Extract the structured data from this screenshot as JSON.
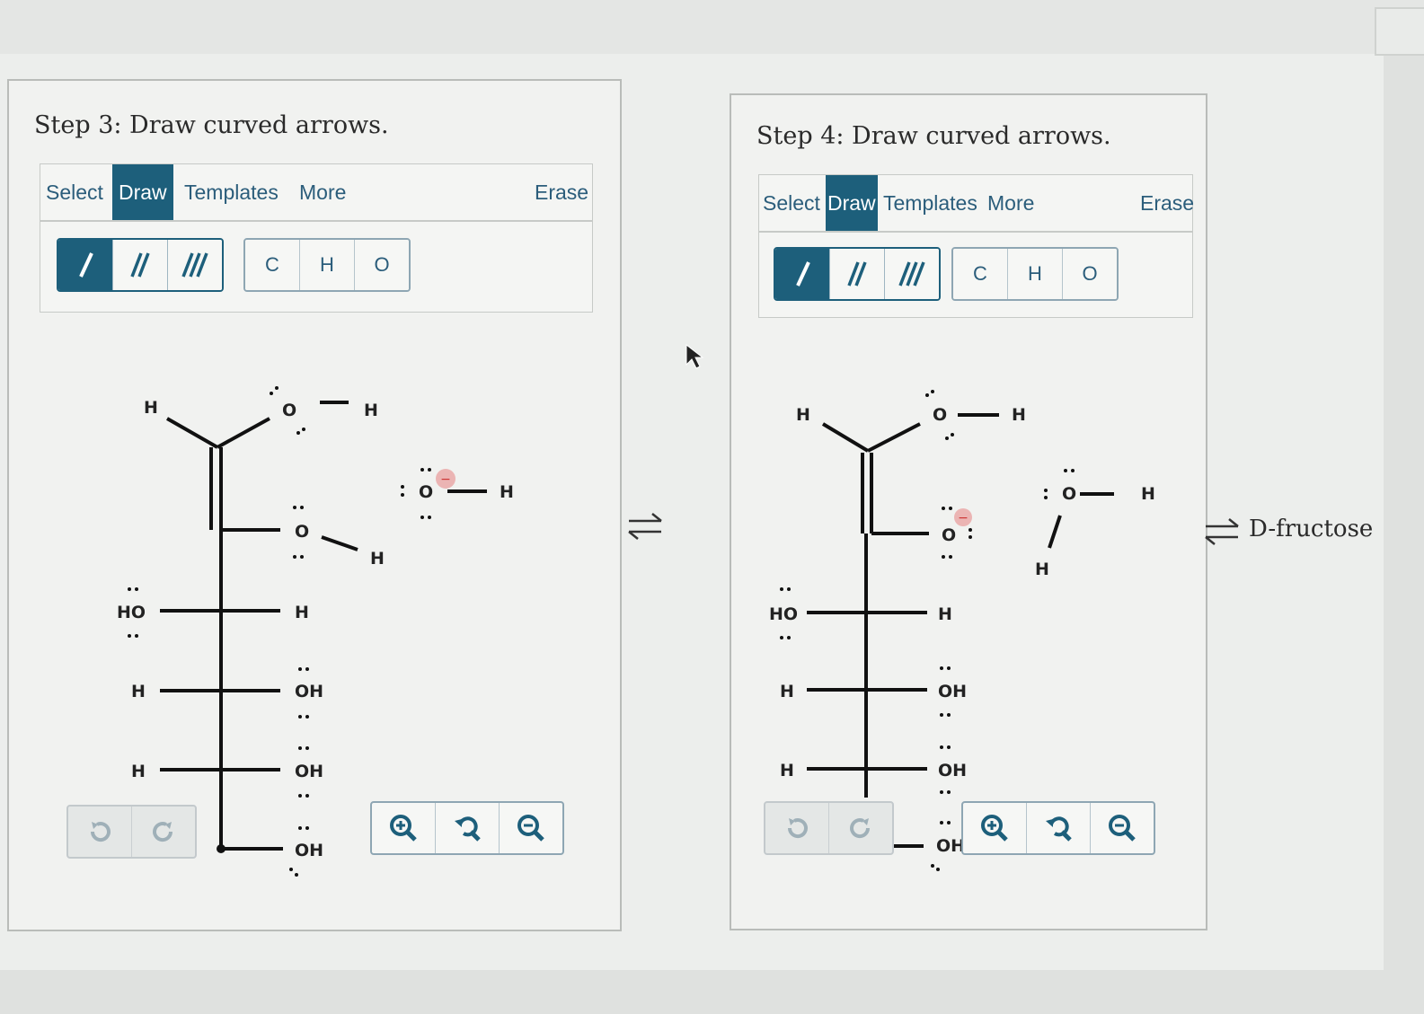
{
  "step3": {
    "title": "Step 3: Draw curved arrows.",
    "menu": {
      "select": "Select",
      "draw": "Draw",
      "templates": "Templates",
      "more": "More",
      "erase": "Erase"
    },
    "atoms": [
      "C",
      "H",
      "O"
    ],
    "labels": {
      "h_top": "H",
      "o_top": "O",
      "h_top_right": "H",
      "o_ring": "O",
      "h_ring": "H",
      "o_hydroxide": "O",
      "h_hydroxide": "H",
      "ho_c3": "HO",
      "h_c3": "H",
      "h_c4": "H",
      "oh_c4": "OH",
      "h_c5": "H",
      "oh_c5": "OH",
      "oh_c6": "OH"
    }
  },
  "step4": {
    "title": "Step 4: Draw curved arrows.",
    "menu": {
      "select": "Select",
      "draw": "Draw",
      "templates": "Templates",
      "more": "More",
      "erase": "Erase"
    },
    "atoms": [
      "C",
      "H",
      "O"
    ],
    "labels": {
      "h_top": "H",
      "o_top": "O",
      "h_top_right": "H",
      "o_ring": "O",
      "o_water": "O",
      "h_water_right": "H",
      "h_water_bottom": "H",
      "ho_c3": "HO",
      "h_c3": "H",
      "h_c4": "H",
      "oh_c4": "OH",
      "h_c5": "H",
      "oh_c5": "OH",
      "oh_c6": "OH"
    }
  },
  "product_label": "D-fructose",
  "colors": {
    "accent": "#1d5f7b",
    "charge": "#e88a8a"
  }
}
